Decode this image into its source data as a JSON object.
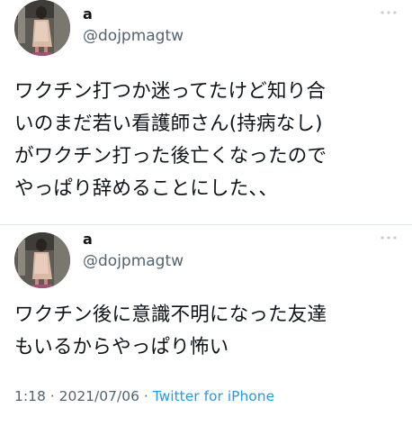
{
  "tweets": [
    {
      "author": {
        "name": "a",
        "handle": "@dojpmagtw"
      },
      "text": "ワクチン打つか迷ってたけど知り合\nいのまだ若い看護師さん(持病なし)\nがワクチン打った後亡くなったので\nやっぱり辞めることにした、、",
      "more_icon": "more-dots-icon"
    },
    {
      "author": {
        "name": "a",
        "handle": "@dojpmagtw"
      },
      "text": "ワクチン後に意識不明になった友達\nもいるからやっぱり怖い",
      "more_icon": "more-dots-icon",
      "meta": {
        "time": "1:18",
        "separator1": " · ",
        "date": "2021/07/06",
        "separator2": " · ",
        "app": "Twitter for iPhone"
      }
    }
  ],
  "colors": {
    "text": "#0f1419",
    "secondary": "#536471",
    "link": "#1d9bf0",
    "divider": "#e1e8ed"
  }
}
